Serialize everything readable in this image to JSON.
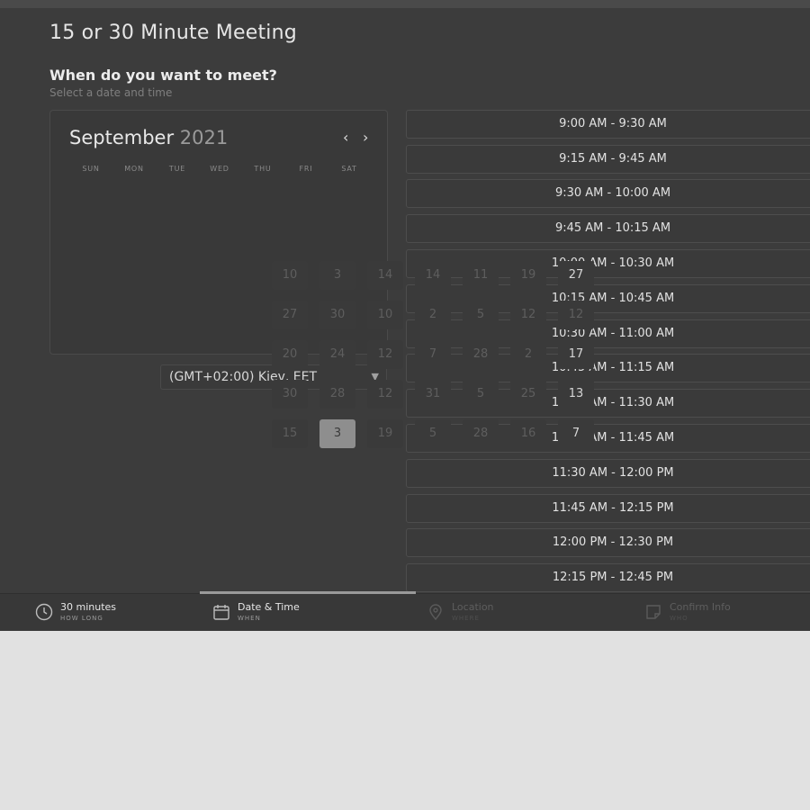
{
  "meeting": {
    "title": "15 or 30 Minute Meeting",
    "question": "When do you want to meet?",
    "subtext": "Select a date and time"
  },
  "calendar": {
    "month": "September",
    "year": "2021",
    "prev_icon": "chevron-left-icon",
    "next_icon": "chevron-right-icon",
    "weekdays": [
      "SUN",
      "MON",
      "TUE",
      "WED",
      "THU",
      "FRI",
      "SAT"
    ],
    "days": [
      [
        "10",
        "3",
        "14",
        "14",
        "11",
        "19",
        "27"
      ],
      [
        "27",
        "30",
        "10",
        "2",
        "5",
        "12",
        "12"
      ],
      [
        "20",
        "24",
        "12",
        "7",
        "28",
        "2",
        "17"
      ],
      [
        "30",
        "28",
        "12",
        "31",
        "5",
        "25",
        "13"
      ],
      [
        "15",
        "3",
        "19",
        "5",
        "28",
        "16",
        "7"
      ]
    ],
    "selected_day": "3"
  },
  "timezone": {
    "label": "(GMT+02:00) Kiev, EET",
    "icon": "chevron-down-icon"
  },
  "time_slots": [
    "9:00 AM - 9:30 AM",
    "9:15 AM - 9:45 AM",
    "9:30 AM - 10:00 AM",
    "9:45 AM - 10:15 AM",
    "10:00 AM - 10:30 AM",
    "10:15 AM - 10:45 AM",
    "10:30 AM - 11:00 AM",
    "10:45 AM - 11:15 AM",
    "11:00 AM - 11:30 AM",
    "11:15 AM - 11:45 AM",
    "11:30 AM - 12:00 PM",
    "11:45 AM - 12:15 PM",
    "12:00 PM - 12:30 PM",
    "12:15 PM - 12:45 PM"
  ],
  "steps": [
    {
      "title": "30 minutes",
      "subtitle": "HOW LONG",
      "icon": "clock-icon",
      "state": "done"
    },
    {
      "title": "Date & Time",
      "subtitle": "WHEN",
      "icon": "calendar-icon",
      "state": "active"
    },
    {
      "title": "Location",
      "subtitle": "WHERE",
      "icon": "map-pin-icon",
      "state": "pending"
    },
    {
      "title": "Confirm Info",
      "subtitle": "WHO",
      "icon": "note-icon",
      "state": "pending"
    }
  ],
  "colors": {
    "background": "#3c3c3c",
    "selected_day": "#8e8e8e",
    "progress": "#9a9a9a"
  }
}
